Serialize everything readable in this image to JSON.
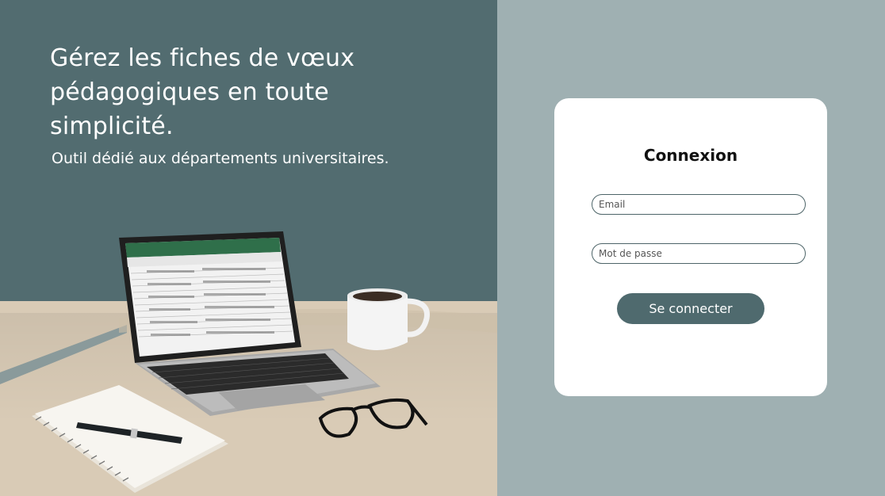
{
  "hero": {
    "title": "Gérez les fiches de vœux pédagogiques en toute simplicité.",
    "subtitle": "Outil dédié aux départements universitaires."
  },
  "login": {
    "title": "Connexion",
    "email_placeholder": "Email",
    "password_placeholder": "Mot de passe",
    "submit_label": "Se connecter"
  },
  "colors": {
    "hero_bg": "#4f6a6e",
    "login_bg": "#9fb0b2",
    "button_bg": "#4f6a6e",
    "card_bg": "#ffffff"
  }
}
